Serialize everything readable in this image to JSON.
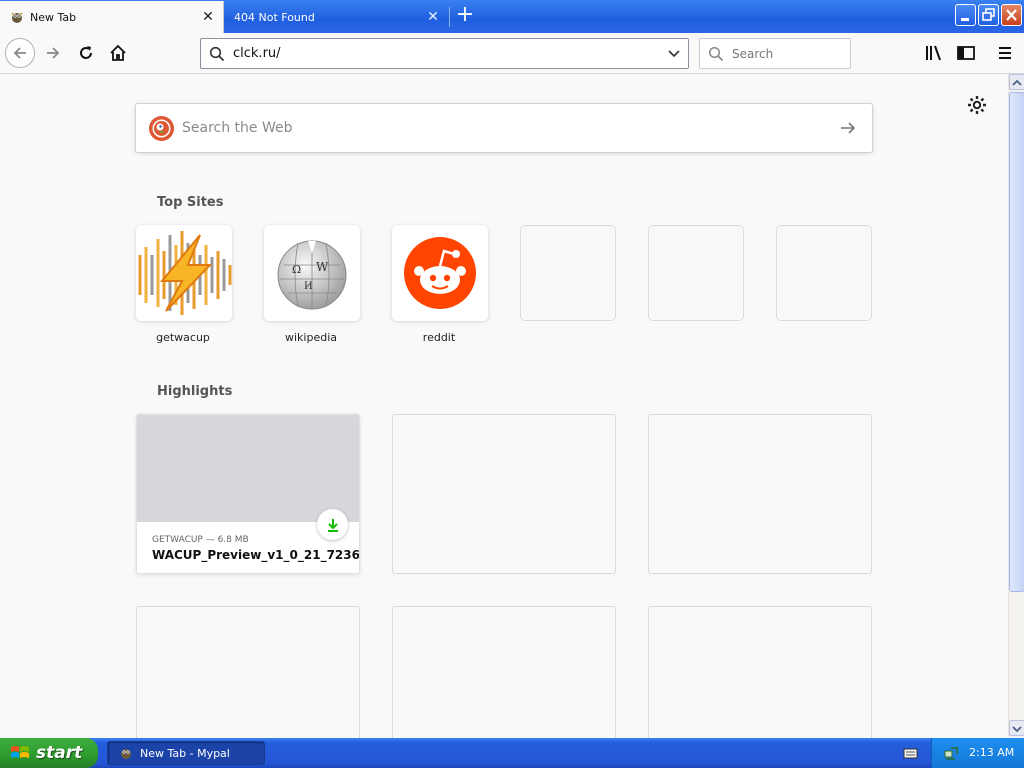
{
  "tabs": [
    {
      "label": "New Tab",
      "active": true
    },
    {
      "label": "404 Not Found",
      "active": false
    }
  ],
  "window_controls": {
    "minimize": "minimize-icon",
    "restore": "restore-icon",
    "close": "close-icon"
  },
  "navbar": {
    "url_value": "clck.ru/",
    "search_placeholder": "Search"
  },
  "newtab": {
    "websearch_placeholder": "Search the Web",
    "top_sites_title": "Top Sites",
    "top_sites": [
      {
        "label": "getwacup",
        "icon": "getwacup-logo"
      },
      {
        "label": "wikipedia",
        "icon": "wikipedia-logo"
      },
      {
        "label": "reddit",
        "icon": "reddit-logo"
      },
      {
        "label": ""
      },
      {
        "label": ""
      },
      {
        "label": ""
      }
    ],
    "highlights_title": "Highlights",
    "highlights": [
      {
        "meta": "GETWACUP — 6.8 MB",
        "title": "WACUP_Preview_v1_0_21_7236....",
        "icon": "download-icon"
      }
    ]
  },
  "taskbar": {
    "start_label": "start",
    "task_item": "New Tab - Mypal",
    "clock": "2:13 AM"
  },
  "colors": {
    "titlebar_blue": "#2a67e6",
    "reddit_orange": "#ff4500",
    "download_green": "#12bc00",
    "start_green": "#2e9a2e"
  }
}
